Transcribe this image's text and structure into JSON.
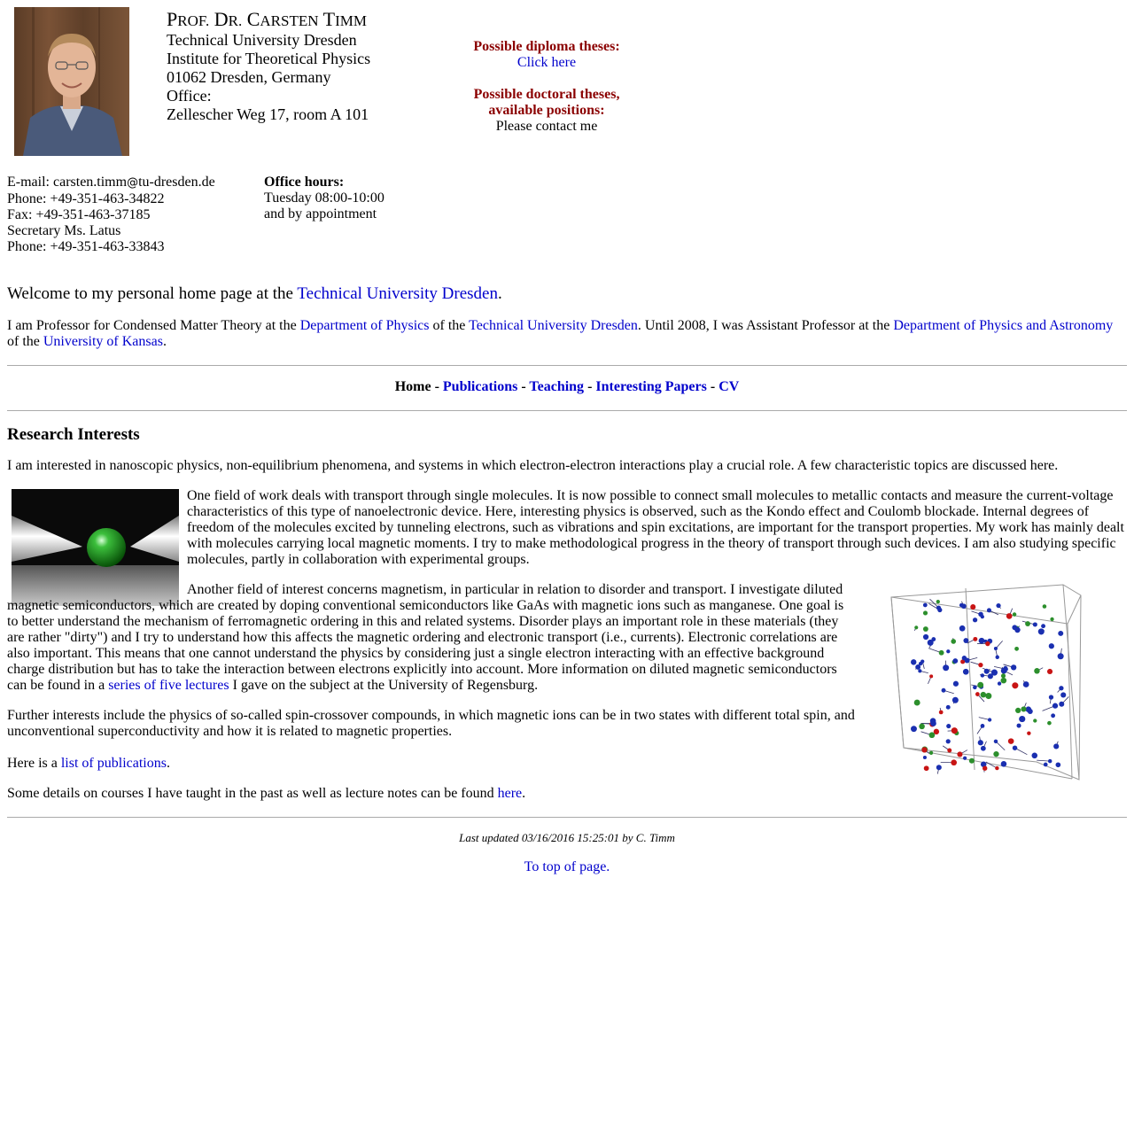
{
  "header": {
    "name_initial_1": "P",
    "name_rest_1": "ROF.",
    "name_initial_2": "D",
    "name_rest_2": "R.",
    "name_initial_3": "C",
    "name_rest_3": "ARSTEN",
    "name_initial_4": "T",
    "name_rest_4": "IMM",
    "address_lines": [
      "Technical University Dresden",
      "Institute for Theoretical Physics",
      "01062 Dresden, Germany",
      "Office:",
      "Zellescher Weg 17, room A 101"
    ]
  },
  "theses": {
    "diploma_heading": "Possible diploma theses:",
    "diploma_link": "Click here",
    "doctoral_heading_1": "Possible doctoral theses,",
    "doctoral_heading_2": "available positions:",
    "contact_text": "Please contact me"
  },
  "contact": {
    "email_label": "E-mail: ",
    "email_user": "carsten.timm",
    "email_at": "@",
    "email_domain": "tu-dresden.de",
    "phone": "Phone: +49-351-463-34822",
    "fax": "Fax: +49-351-463-37185",
    "secretary": "Secretary Ms. Latus",
    "secretary_phone": "Phone: +49-351-463-33843"
  },
  "office_hours": {
    "heading": "Office hours:",
    "line1": "Tuesday 08:00-10:00",
    "line2": "and by appointment"
  },
  "welcome": {
    "text": "Welcome to my personal home page at the ",
    "link": "Technical University Dresden",
    "end": "."
  },
  "intro": {
    "t1": "I am Professor for Condensed Matter Theory at the ",
    "l1": "Department of Physics",
    "t2": " of the ",
    "l2": "Technical University Dresden",
    "t3": ". Until 2008, I was Assistant Professor at the ",
    "l3": "Department of Physics and Astronomy",
    "t4": " of the ",
    "l4": "University of Kansas",
    "t5": "."
  },
  "nav": {
    "home": "Home",
    "sep": " - ",
    "publications": "Publications",
    "teaching": "Teaching",
    "papers": "Interesting Papers",
    "cv": "CV"
  },
  "research": {
    "heading": "Research Interests",
    "intro": "I am interested in nanoscopic physics, non-equilibrium phenomena, and systems in which electron-electron interactions play a crucial role. A few characteristic topics are discussed here.",
    "transport": "One field of work deals with transport through single molecules. It is now possible to connect small molecules to metallic contacts and measure the current-voltage characteristics of this type of nanoelectronic device. Here, interesting physics is observed, such as the Kondo effect and Coulomb blockade. Internal degrees of freedom of the molecules excited by tunneling electrons, such as vibrations and spin excitations, are important for the transport properties. My work has mainly dealt with molecules carrying local magnetic moments. I try to make methodological progress in the theory of transport through such devices. I am also studying specific molecules, partly in collaboration with experimental groups.",
    "magnetism": "Another field of interest concerns magnetism, in particular in relation to disorder and transport. I investigate diluted magnetic semiconductors, which are created by doping conventional semiconductors like GaAs with magnetic ions such as manganese. One goal is to better understand the mechanism of ferromagnetic ordering in this and related systems. Disorder plays an important role in these materials (they are rather \"dirty\") and I try to understand how this affects the magnetic ordering and electronic transport (i.e., currents). Electronic correlations are also important. This means that one cannot understand the physics by considering just a single electron interacting with an effective background charge distribution but has to take the interaction between electrons explicitly into account. More information on diluted magnetic semiconductors can be found in a ",
    "lectures_link": "series of five lectures",
    "magnetism_end": " I gave on the subject at the University of Regensburg.",
    "further": "Further interests include the physics of so-called spin-crossover compounds, in which magnetic ions can be in two states with different total spin, and unconventional superconductivity and how it is related to magnetic properties.",
    "publist_text": "Here is a ",
    "publist_link": "list of publications",
    "publist_end": ".",
    "courses_text": "Some details on courses I have taught in the past as well as lecture notes can be found ",
    "courses_link": "here",
    "courses_end": "."
  },
  "footer": {
    "updated": "Last updated 03/16/2016 15:25:01 by C. Timm",
    "top_link": "To top of page."
  },
  "colors": {
    "link": "#0000cc",
    "heading_red": "#8b0000",
    "rule": "#aaaaaa"
  }
}
